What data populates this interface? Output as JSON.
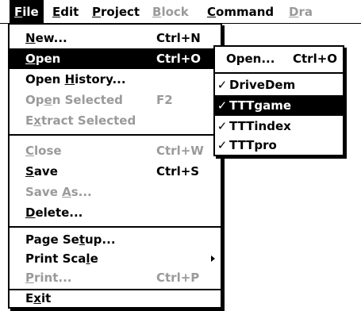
{
  "menubar": {
    "items": [
      {
        "label": "File",
        "mnemonic": "F",
        "rest": "ile",
        "state": "active"
      },
      {
        "label": "Edit",
        "mnemonic": "E",
        "rest": "dit",
        "state": "normal"
      },
      {
        "label": "Project",
        "mnemonic": "P",
        "rest": "roject",
        "state": "normal"
      },
      {
        "label": "Block",
        "mnemonic": "B",
        "rest": "lock",
        "state": "disabled"
      },
      {
        "label": "Command",
        "mnemonic": "C",
        "rest": "ommand",
        "state": "normal"
      },
      {
        "label": "Dra",
        "mnemonic": "D",
        "rest": "ra",
        "state": "disabled"
      }
    ]
  },
  "file_menu": {
    "items": [
      {
        "pre": "",
        "u": "N",
        "post": "ew...",
        "accel": "Ctrl+N",
        "state": "normal"
      },
      {
        "pre": "",
        "u": "O",
        "post": "pen",
        "accel": "Ctrl+O",
        "state": "selected"
      },
      {
        "pre": "Open ",
        "u": "H",
        "post": "istory...",
        "accel": "",
        "state": "normal"
      },
      {
        "pre": "Op",
        "u": "e",
        "post": "n Selected",
        "accel": "F2",
        "state": "disabled"
      },
      {
        "pre": "E",
        "u": "x",
        "post": "tract Selected",
        "accel": "",
        "state": "disabled"
      },
      {
        "pre": "",
        "u": "C",
        "post": "lose",
        "accel": "Ctrl+W",
        "state": "disabled"
      },
      {
        "pre": "",
        "u": "S",
        "post": "ave",
        "accel": "Ctrl+S",
        "state": "normal"
      },
      {
        "pre": "Save ",
        "u": "A",
        "post": "s...",
        "accel": "",
        "state": "disabled"
      },
      {
        "pre": "",
        "u": "D",
        "post": "elete...",
        "accel": "",
        "state": "normal"
      },
      {
        "pre": "Page Se",
        "u": "t",
        "post": "up...",
        "accel": "",
        "state": "normal"
      },
      {
        "pre": "Print Sca",
        "u": "l",
        "post": "e",
        "accel": "",
        "state": "normal",
        "submenu": true
      },
      {
        "pre": "",
        "u": "P",
        "post": "rint...",
        "accel": "Ctrl+P",
        "state": "disabled"
      },
      {
        "pre": "E",
        "u": "x",
        "post": "it",
        "accel": "",
        "state": "normal"
      }
    ]
  },
  "open_submenu": {
    "header": {
      "label": "Open...",
      "accel": "Ctrl+O"
    },
    "items": [
      {
        "label": "DriveDem",
        "checked": true,
        "state": "normal"
      },
      {
        "label": "TTTgame",
        "checked": true,
        "state": "selected"
      },
      {
        "label": "TTTindex",
        "checked": true,
        "state": "normal"
      },
      {
        "label": "TTTpro",
        "checked": true,
        "state": "normal"
      }
    ],
    "check_glyph": "✓"
  }
}
